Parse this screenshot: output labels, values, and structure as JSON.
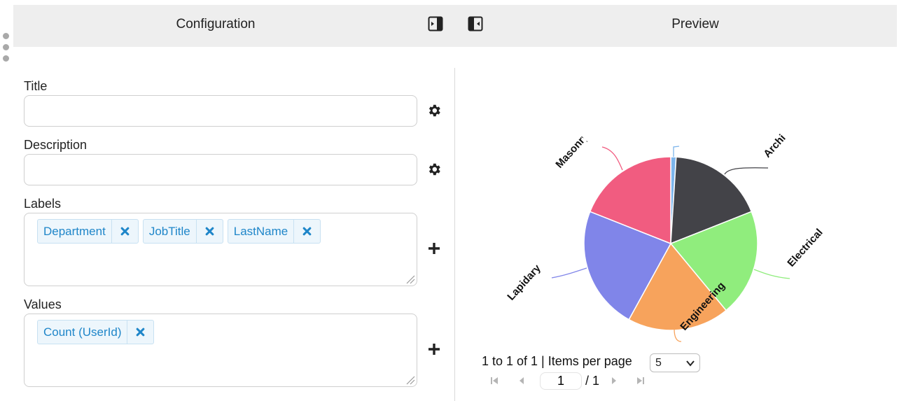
{
  "header": {
    "config_title": "Configuration",
    "preview_title": "Preview"
  },
  "form": {
    "title_label": "Title",
    "title_value": "",
    "description_label": "Description",
    "description_value": "",
    "labels_label": "Labels",
    "labels_tags": [
      "Department",
      "JobTitle",
      "LastName"
    ],
    "values_label": "Values",
    "values_tags": [
      "Count (UserId)"
    ]
  },
  "icons": {
    "collapse_right": "sidebar-collapse-right-icon",
    "collapse_left": "sidebar-collapse-left-icon",
    "settings": "gear-icon",
    "add": "plus-icon",
    "remove": "times-icon"
  },
  "chart_data": {
    "type": "pie",
    "title": "",
    "slices": [
      {
        "label": "",
        "value": 1,
        "color": "#7cb5ec"
      },
      {
        "label": "Architecture",
        "value": 18,
        "color": "#434348"
      },
      {
        "label": "Electrical",
        "value": 20,
        "color": "#90ed7d"
      },
      {
        "label": "Engineering",
        "value": 19,
        "color": "#f7a35c"
      },
      {
        "label": "Lapidary",
        "value": 23,
        "color": "#8085e9"
      },
      {
        "label": "Masonry",
        "value": 19,
        "color": "#f15c80"
      }
    ]
  },
  "pagination": {
    "summary": "1 to 1 of 1 | Items per page",
    "page_size": "5",
    "current_page": "1",
    "total_pages": "/ 1"
  }
}
